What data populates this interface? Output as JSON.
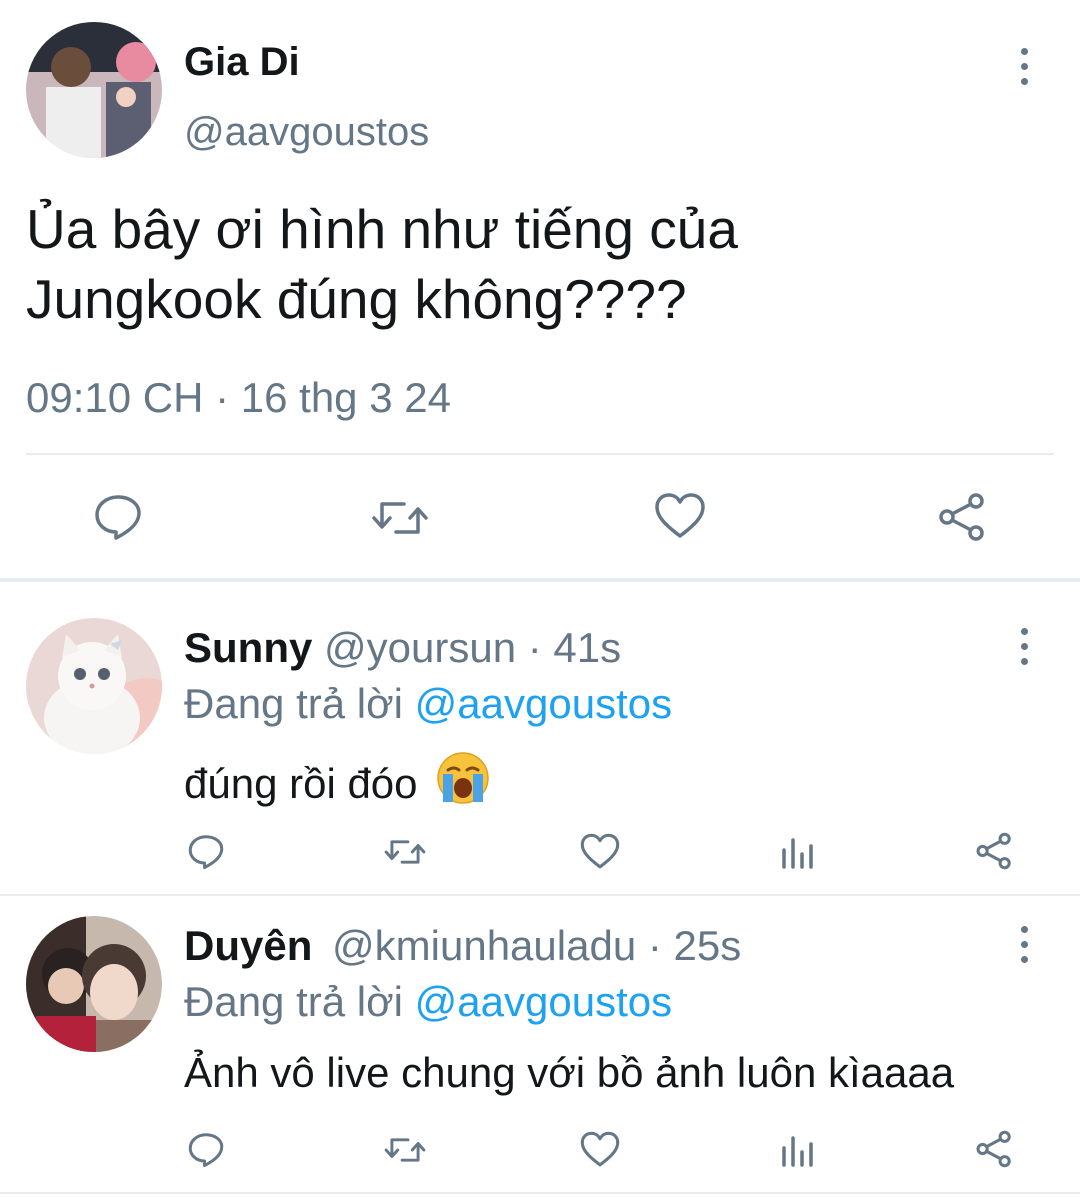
{
  "main_tweet": {
    "name": "Gia Di",
    "handle": "@aavgoustos",
    "text_line1": "Ủa bây ơi hình như tiếng của",
    "text_line2": "Jungkook đúng không????",
    "timestamp": "09:10 CH · 16 thg 3 24",
    "icons": [
      "reply-icon",
      "retweet-icon",
      "like-icon",
      "share-icon"
    ]
  },
  "replies": [
    {
      "name": "Sunny",
      "handle": "@yoursun",
      "time": "· 41s",
      "replying_prefix": "Đang trả lời",
      "replying_to": "@aavgoustos",
      "text": "đúng rồi đóo",
      "emoji": "😭"
    },
    {
      "name": "Duyên",
      "handle": "@kmiunhauladu",
      "time": "· 25s",
      "replying_prefix": "Đang trả lời",
      "replying_to": "@aavgoustos",
      "text": "Ảnh vô live chung với bồ ảnh luôn kìaaaa"
    }
  ],
  "colors": {
    "text": "#14171a",
    "muted": "#657786",
    "link": "#1da1f2",
    "divider": "#e6ecf0"
  }
}
